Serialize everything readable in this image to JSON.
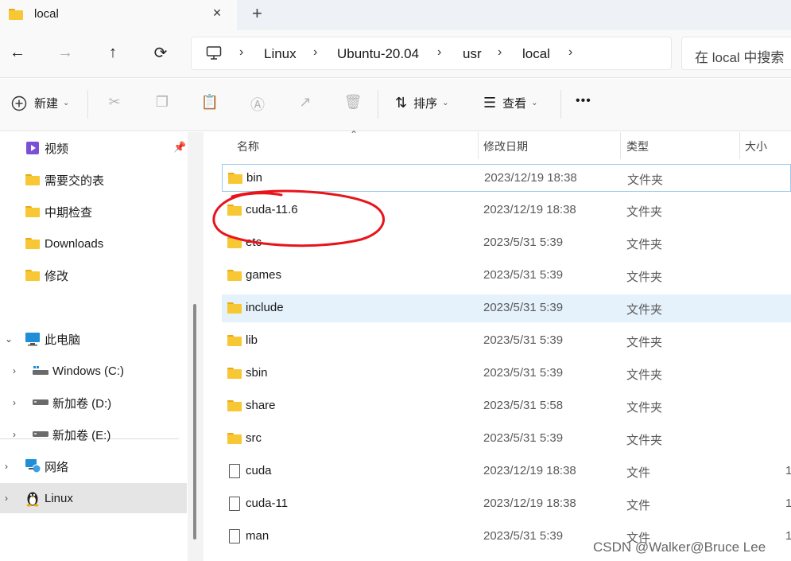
{
  "tab": {
    "title": "local",
    "close_icon": "×",
    "new_tab_icon": "+"
  },
  "nav": {
    "back_icon": "←",
    "forward_icon": "→",
    "up_icon": "↑",
    "refresh_icon": "⟳",
    "breadcrumbs": [
      "Linux",
      "Ubuntu-20.04",
      "usr",
      "local"
    ],
    "separator": "›",
    "search_placeholder": "在 local 中搜索"
  },
  "toolbar": {
    "new_label": "新建",
    "sort_label": "排序",
    "view_label": "查看",
    "more_icon": "•••"
  },
  "sidebar": {
    "quick": [
      {
        "label": "视频",
        "icon": "video-folder-icon"
      },
      {
        "label": "需要交的表",
        "icon": "folder-icon"
      },
      {
        "label": "中期检查",
        "icon": "folder-icon"
      },
      {
        "label": "Downloads",
        "icon": "folder-icon"
      },
      {
        "label": "修改",
        "icon": "folder-icon"
      }
    ],
    "tree": [
      {
        "label": "此电脑",
        "icon": "computer-icon",
        "expand": "⌄"
      },
      {
        "label": "Windows (C:)",
        "icon": "drive-icon",
        "expand": "›"
      },
      {
        "label": "新加卷 (D:)",
        "icon": "drive-icon",
        "expand": "›"
      },
      {
        "label": "新加卷 (E:)",
        "icon": "drive-icon",
        "expand": "›"
      },
      {
        "label": "网络",
        "icon": "network-icon",
        "expand": "›"
      },
      {
        "label": "Linux",
        "icon": "linux-icon",
        "expand": "›"
      }
    ]
  },
  "columns": {
    "name": "名称",
    "modified": "修改日期",
    "type": "类型",
    "size": "大小"
  },
  "files": [
    {
      "name": "bin",
      "date": "2023/12/19 18:38",
      "type": "文件夹",
      "size": "",
      "kind": "folder"
    },
    {
      "name": "cuda-11.6",
      "date": "2023/12/19 18:38",
      "type": "文件夹",
      "size": "",
      "kind": "folder"
    },
    {
      "name": "etc",
      "date": "2023/5/31 5:39",
      "type": "文件夹",
      "size": "",
      "kind": "folder"
    },
    {
      "name": "games",
      "date": "2023/5/31 5:39",
      "type": "文件夹",
      "size": "",
      "kind": "folder"
    },
    {
      "name": "include",
      "date": "2023/5/31 5:39",
      "type": "文件夹",
      "size": "",
      "kind": "folder"
    },
    {
      "name": "lib",
      "date": "2023/5/31 5:39",
      "type": "文件夹",
      "size": "",
      "kind": "folder"
    },
    {
      "name": "sbin",
      "date": "2023/5/31 5:39",
      "type": "文件夹",
      "size": "",
      "kind": "folder"
    },
    {
      "name": "share",
      "date": "2023/5/31 5:58",
      "type": "文件夹",
      "size": "",
      "kind": "folder"
    },
    {
      "name": "src",
      "date": "2023/5/31 5:39",
      "type": "文件夹",
      "size": "",
      "kind": "folder"
    },
    {
      "name": "cuda",
      "date": "2023/12/19 18:38",
      "type": "文件",
      "size": "1",
      "kind": "file"
    },
    {
      "name": "cuda-11",
      "date": "2023/12/19 18:38",
      "type": "文件",
      "size": "1",
      "kind": "file"
    },
    {
      "name": "man",
      "date": "2023/5/31 5:39",
      "type": "文件",
      "size": "1",
      "kind": "file"
    }
  ],
  "annotation_color": "#e8141b",
  "watermark": "CSDN @Walker@Bruce Lee"
}
